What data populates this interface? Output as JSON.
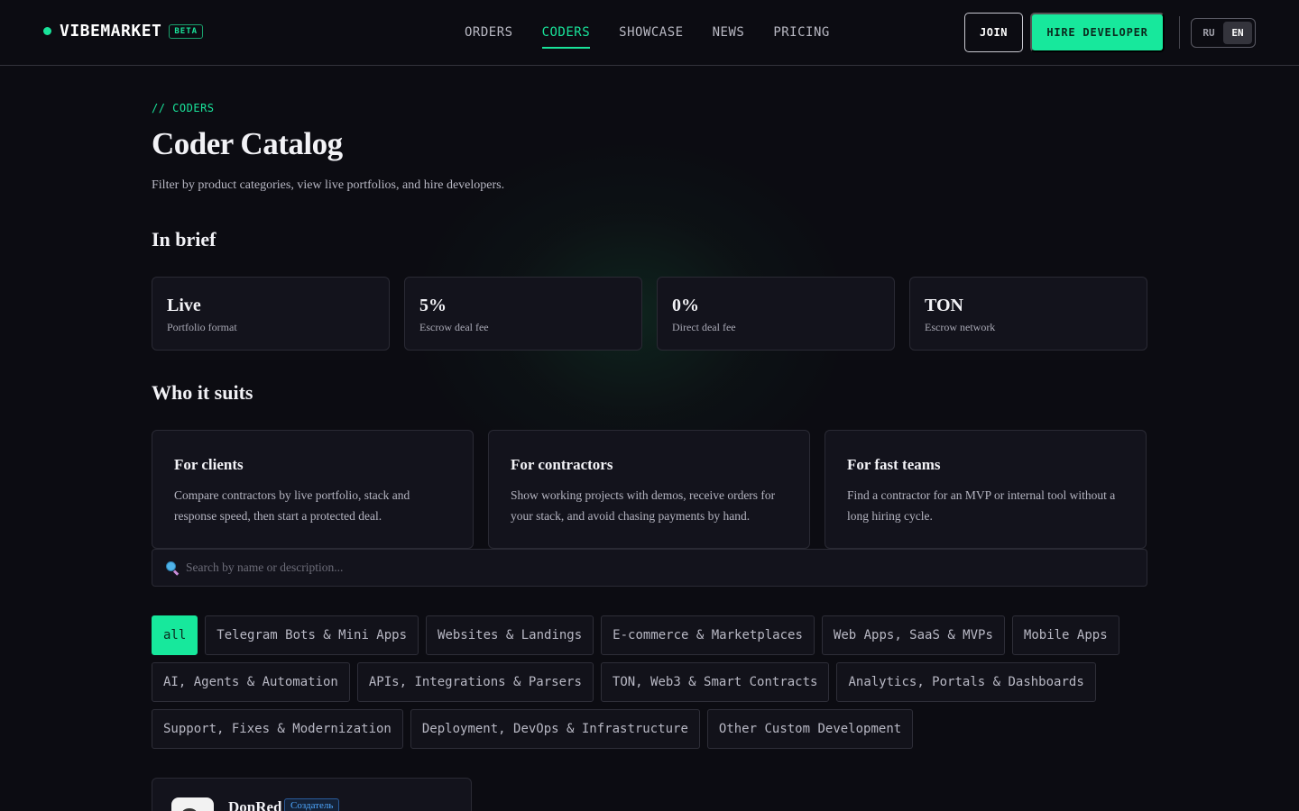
{
  "header": {
    "logo_text": "VIBEMARKET",
    "beta_label": "BETA",
    "nav": [
      {
        "label": "ORDERS",
        "active": false
      },
      {
        "label": "CODERS",
        "active": true
      },
      {
        "label": "SHOWCASE",
        "active": false
      },
      {
        "label": "NEWS",
        "active": false
      },
      {
        "label": "PRICING",
        "active": false
      }
    ],
    "join_label": "JOIN",
    "hire_label": "HIRE DEVELOPER",
    "lang": {
      "ru": "RU",
      "en": "EN",
      "selected": "EN"
    }
  },
  "page": {
    "eyebrow": "// CODERS",
    "title": "Coder Catalog",
    "subtitle": "Filter by product categories, view live portfolios, and hire developers."
  },
  "brief": {
    "heading": "In brief",
    "stats": [
      {
        "value": "Live",
        "label": "Portfolio format"
      },
      {
        "value": "5%",
        "label": "Escrow deal fee"
      },
      {
        "value": "0%",
        "label": "Direct deal fee"
      },
      {
        "value": "TON",
        "label": "Escrow network"
      }
    ]
  },
  "suits": {
    "heading": "Who it suits",
    "cards": [
      {
        "title": "For clients",
        "text": "Compare contractors by live portfolio, stack and response speed, then start a protected deal."
      },
      {
        "title": "For contractors",
        "text": "Show working projects with demos, receive orders for your stack, and avoid chasing payments by hand."
      },
      {
        "title": "For fast teams",
        "text": "Find a contractor for an MVP or internal tool without a long hiring cycle."
      }
    ]
  },
  "search": {
    "placeholder": "Search by name or description...",
    "value": ""
  },
  "categories": {
    "selected": "all",
    "items": [
      "all",
      "Telegram Bots & Mini Apps",
      "Websites & Landings",
      "E-commerce & Marketplaces",
      "Web Apps, SaaS & MVPs",
      "Mobile Apps",
      "AI, Agents & Automation",
      "APIs, Integrations & Parsers",
      "TON, Web3 & Smart Contracts",
      "Analytics, Portals & Dashboards",
      "Support, Fixes & Modernization",
      "Deployment, DevOps & Infrastructure",
      "Other Custom Development"
    ]
  },
  "coders": [
    {
      "name": "DonRed",
      "badge": "Создатель"
    }
  ],
  "colors": {
    "accent": "#17e89c",
    "background": "#0c0c12",
    "card": "#13131c",
    "border": "#2a2a34"
  }
}
